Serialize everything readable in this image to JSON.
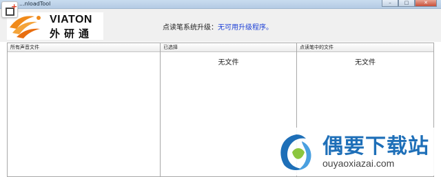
{
  "window": {
    "title": "...nloadTool",
    "controls": {
      "minimize": "–",
      "maximize": "□",
      "close": "✕"
    }
  },
  "header": {
    "logo_text": "VIATON",
    "logo_cn": "外研通",
    "status_label": "点读笔系统升级：",
    "status_value": "无可用升级程序。"
  },
  "panels": [
    {
      "title": "所有声音文件",
      "empty_text": ""
    },
    {
      "title": "已选择",
      "empty_text": "无文件"
    },
    {
      "title": "点读笔中的文件",
      "empty_text": "无文件"
    }
  ],
  "watermark": {
    "title": "偶要下载站",
    "url": "ouyaoxiazai.com"
  },
  "colors": {
    "status_value": "#1c3fd6",
    "watermark_title": "#1e6fb8",
    "logo_orange": "#f08a1a"
  },
  "icons": {
    "corner": "new-window-icon",
    "logo": "viaton-logo-icon",
    "watermark": "ouyaoxiazai-logo-icon"
  }
}
